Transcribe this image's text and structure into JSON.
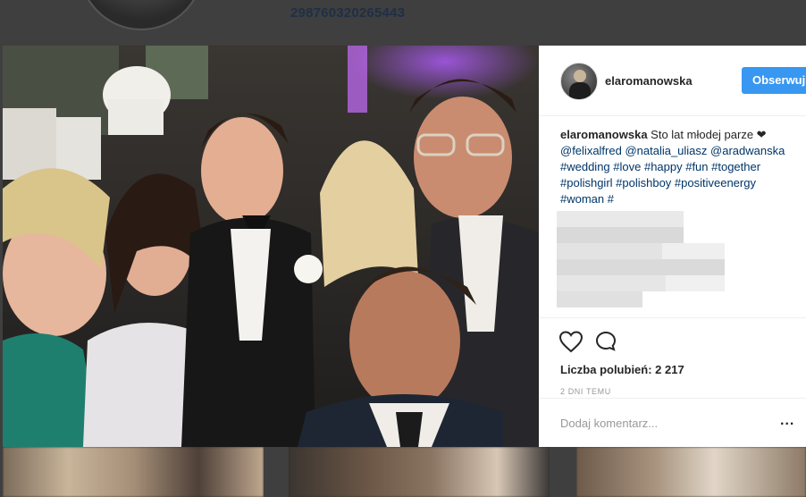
{
  "background": {
    "profile_id": "29876032026544 3"
  },
  "post": {
    "username": "elaromanowska",
    "follow_label": "Obserwuj",
    "caption_user": "elaromanowska",
    "caption_text": "Sto lat młodej parze ❤",
    "caption_tags_line1": "@felixalfred @natalia_uliasz @aradwanska",
    "caption_tags_line2": "#wedding #love #happy #fun #together",
    "caption_tags_line3": "#polishgirl #polishboy #positiveenergy",
    "caption_tags_line4": "#woman #",
    "likes": "Liczba polubień: 2 217",
    "date": "2 DNI TEMU",
    "comment_placeholder": "Dodaj komentarz...",
    "more": "..."
  },
  "colors": {
    "accent": "#3897f0",
    "link": "#003569"
  },
  "icons": [
    "heart-icon",
    "comment-icon",
    "more-options-icon"
  ]
}
